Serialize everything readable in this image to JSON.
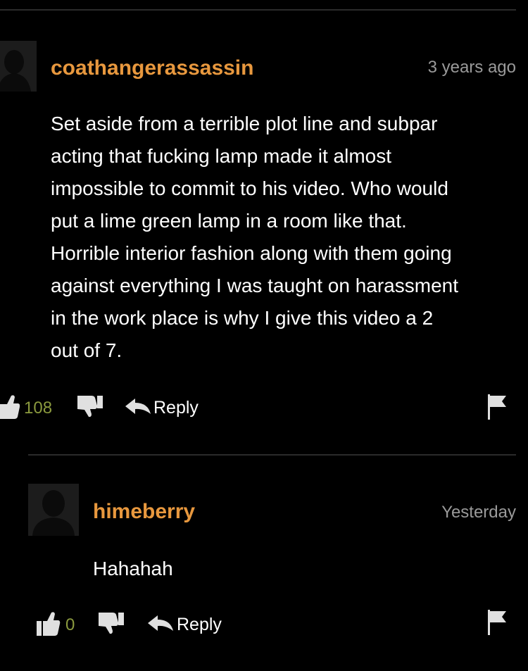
{
  "comments": [
    {
      "username": "coathangerassassin",
      "timestamp": "3 years ago",
      "lines": [
        "Set aside from a terrible plot line and subpar",
        "acting that fucking lamp made it almost",
        "impossible to commit to his video. Who would",
        "put a lime green lamp in a room like that.",
        "Horrible interior fashion along with them going",
        "against everything I was taught on harassment",
        "in the work place is why I give this video a 2",
        "out of 7."
      ],
      "likes": "108",
      "reply_label": "Reply"
    },
    {
      "username": "himeberry",
      "timestamp": "Yesterday",
      "lines": [
        "Hahahah"
      ],
      "likes": "0",
      "reply_label": "Reply"
    }
  ],
  "colors": {
    "username": "#e8983e",
    "timestamp": "#9a9a9a",
    "like_count": "#8b9a3e",
    "icon": "#e0e0e0",
    "background": "#000000"
  }
}
